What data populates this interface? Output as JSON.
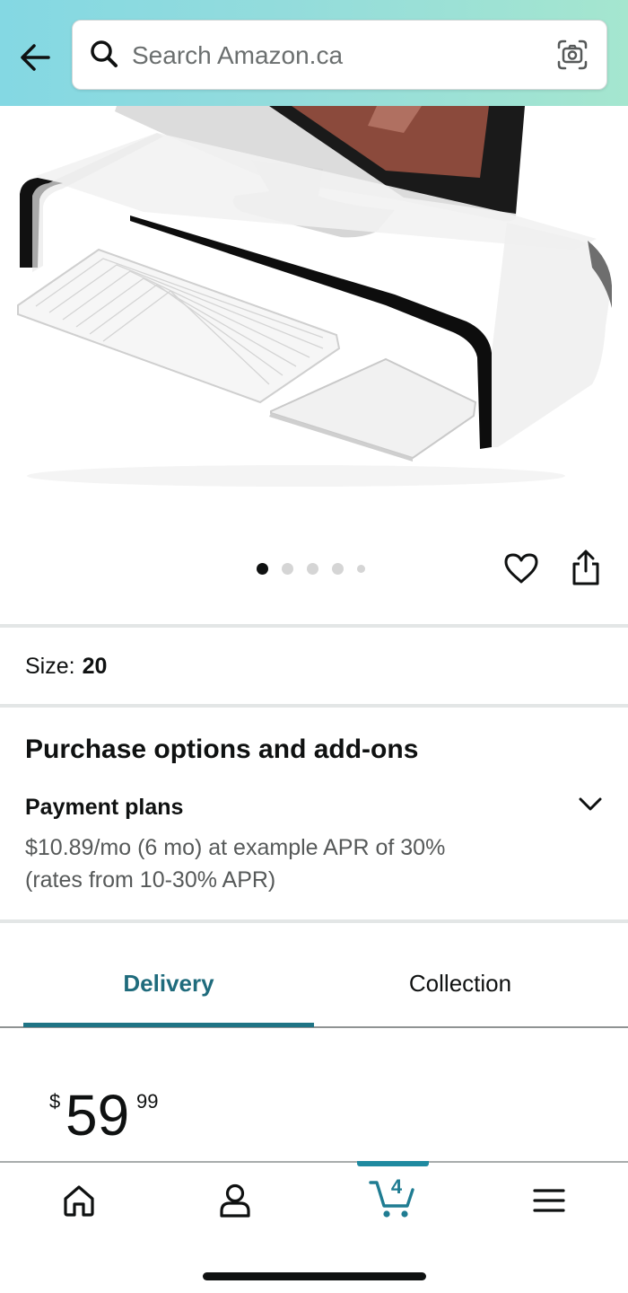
{
  "header": {
    "search_placeholder": "Search Amazon.ca"
  },
  "icons": {
    "back": "back-arrow-icon",
    "search": "search-icon",
    "camera": "camera-scan-icon",
    "wishlist": "heart-icon",
    "share": "share-icon",
    "expand": "chevron-down-icon",
    "home": "home-icon",
    "account": "person-icon",
    "cart": "cart-icon",
    "menu": "hamburger-menu-icon"
  },
  "carousel": {
    "image_count": 5,
    "active_index": 0
  },
  "size": {
    "label": "Size:",
    "value": "20"
  },
  "purchase_options": {
    "title": "Purchase options and add-ons",
    "payment_plans_label": "Payment plans",
    "payment_plans_line1": "$10.89/mo (6 mo) at example APR of 30%",
    "payment_plans_line2": "(rates from 10-30% APR)"
  },
  "tabs": [
    {
      "label": "Delivery",
      "selected": true
    },
    {
      "label": "Collection",
      "selected": false
    }
  ],
  "price": {
    "symbol": "$",
    "whole": "59",
    "fraction": "99"
  },
  "bottom_nav": {
    "cart_count": "4",
    "active": "cart"
  },
  "colors": {
    "header_gradient_start": "#84d8e3",
    "header_gradient_end": "#a5e6cf",
    "tab_selected": "#1f6b7c",
    "cart_accent": "#1f8aa0"
  }
}
